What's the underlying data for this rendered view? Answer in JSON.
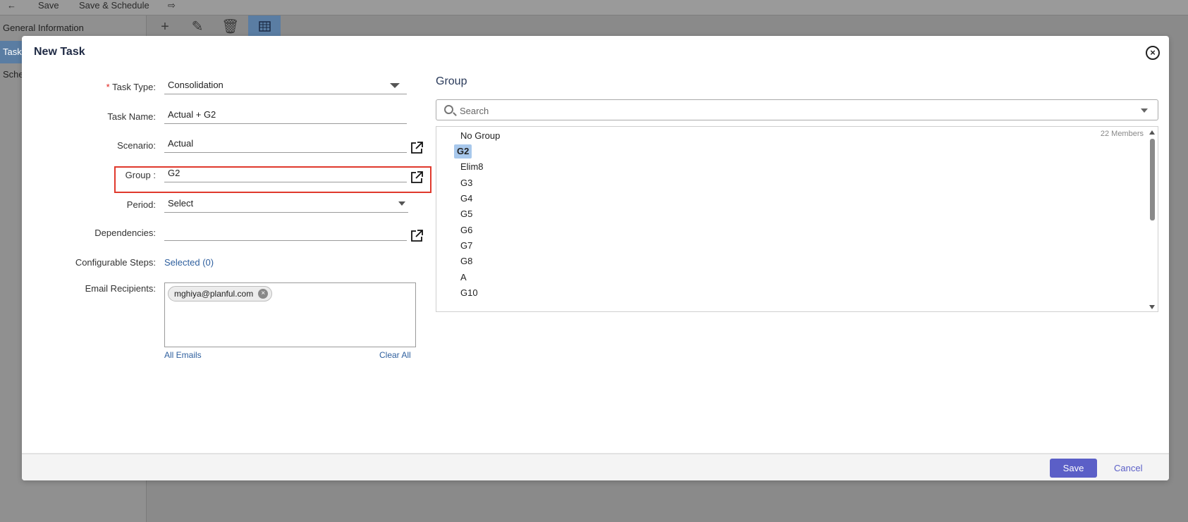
{
  "background": {
    "toolbar": {
      "save_label": "Save",
      "save_schedule_label": "Save & Schedule"
    },
    "sidebar": {
      "items": [
        "General Information",
        "Task",
        "Sche"
      ]
    }
  },
  "modal": {
    "title": "New Task",
    "form": {
      "task_type": {
        "label": "Task Type:",
        "value": "Consolidation"
      },
      "task_name": {
        "label": "Task Name:",
        "value": "Actual + G2"
      },
      "scenario": {
        "label": "Scenario:",
        "value": "Actual"
      },
      "group": {
        "label": "Group :",
        "value": "G2"
      },
      "period": {
        "label": "Period:",
        "value": "Select"
      },
      "dependencies": {
        "label": "Dependencies:",
        "value": ""
      },
      "configurable_steps": {
        "label": "Configurable Steps:",
        "value": "Selected (0)"
      },
      "email_recipients": {
        "label": "Email Recipients:",
        "chips": [
          "mghiya@planful.com"
        ]
      },
      "all_emails_label": "All Emails",
      "clear_all_label": "Clear All"
    },
    "group_panel": {
      "title": "Group",
      "search_placeholder": "Search",
      "members_count": "22 Members",
      "items": [
        "No Group",
        "G2",
        "Elim8",
        "G3",
        "G4",
        "G5",
        "G6",
        "G7",
        "G8",
        "A",
        "G10"
      ],
      "selected": "G2"
    },
    "footer": {
      "save_label": "Save",
      "cancel_label": "Cancel"
    }
  },
  "colors": {
    "primary": "#5b5fc7",
    "highlight_border": "#e0392c",
    "selected_item": "#a8c8ec",
    "link": "#2e5f9e"
  }
}
